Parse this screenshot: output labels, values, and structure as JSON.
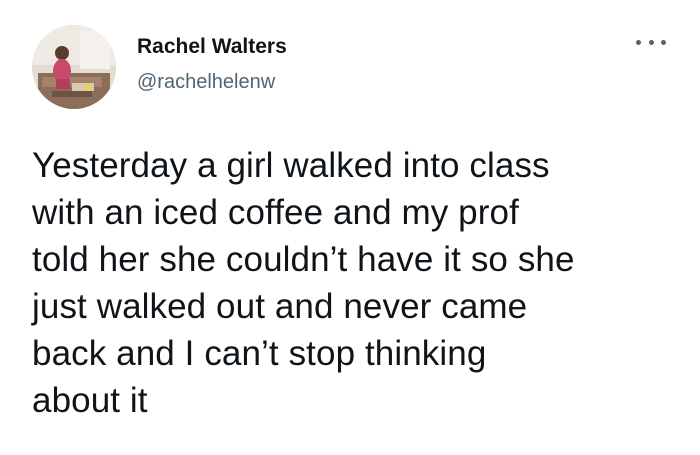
{
  "author": {
    "display_name": "Rachel Walters",
    "handle": "@rachelhelenw",
    "avatar_icon": "profile-photo-icon"
  },
  "menu": {
    "more_icon": "more-horizontal-icon"
  },
  "tweet": {
    "lines": [
      "Yesterday a girl walked into class",
      "with an iced coffee and my prof",
      "told her she couldn’t have it so she",
      "just walked out and never came",
      "back and I can’t stop thinking",
      "about it"
    ]
  },
  "colors": {
    "text_primary": "#0f1419",
    "text_secondary": "#536471",
    "background": "#ffffff"
  }
}
